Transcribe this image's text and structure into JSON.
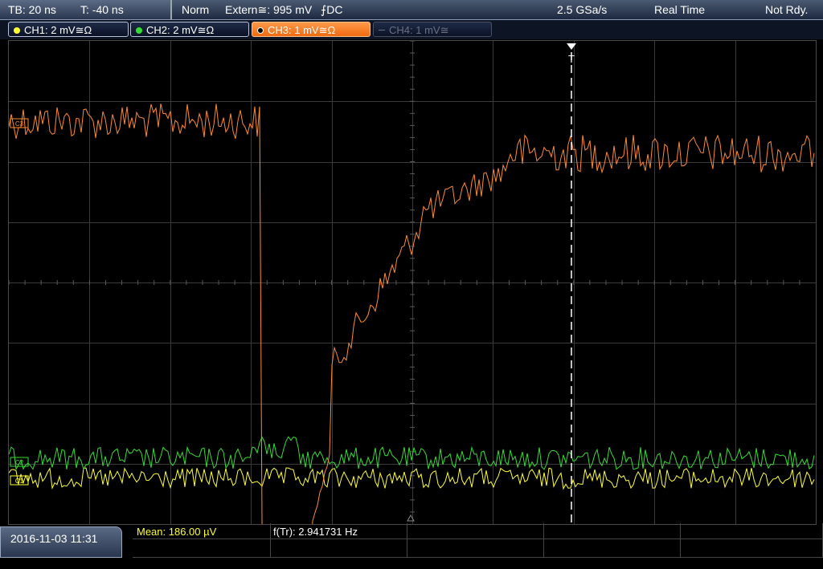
{
  "status_bar": {
    "timebase": "TB: 20 ns",
    "trigger_time": "T: -40 ns",
    "mode": "Norm",
    "trigger_source": "Extern≅: 995 mV",
    "trigger_slope_coupling": "⨍DC",
    "sample_rate": "2.5 GSa/s",
    "acquisition": "Real Time",
    "state": "Not Rdy."
  },
  "channels": [
    {
      "label": "CH1: 2 mV≅Ω",
      "color": "#ffff33",
      "active": false,
      "enabled": true
    },
    {
      "label": "CH2: 2 mV≅Ω",
      "color": "#33dd33",
      "active": false,
      "enabled": true
    },
    {
      "label": "CH3: 1 mV≅Ω",
      "color": "#ff8a30",
      "active": true,
      "enabled": true
    },
    {
      "label": "CH4: 1 mV≅",
      "color": "#6a7080",
      "active": false,
      "enabled": false
    }
  ],
  "markers": {
    "trigger_marker": "T",
    "ch1_marker": "C1",
    "ch2_marker": "C2",
    "ch3_marker": "C3"
  },
  "measurements": {
    "mean": "Mean: 186.00 µV",
    "freq": "f(Tr): 2.941731 Hz"
  },
  "timestamp": "2016-11-03 11:31",
  "colors": {
    "ch1": "#ffff33",
    "ch2": "#33dd33",
    "ch3": "#ff8a30",
    "grid": "#3a3a3a",
    "accent": "#f06a10"
  },
  "chart_data": {
    "type": "line",
    "grid_divisions": {
      "x": 10,
      "y": 8
    },
    "grid": true,
    "series": [
      {
        "name": "CH3: 1 mV≅Ω",
        "description": "orange trace: high noisy level, sharp drop near division 3.1, slow rise from division 4 to 5, settles high"
      },
      {
        "name": "CH2: 2 mV≅Ω",
        "description": "green noisy baseline near bottom, small bump at division 3"
      },
      {
        "name": "CH1: 2 mV≅Ω",
        "description": "yellow noisy baseline near bottom"
      }
    ]
  }
}
